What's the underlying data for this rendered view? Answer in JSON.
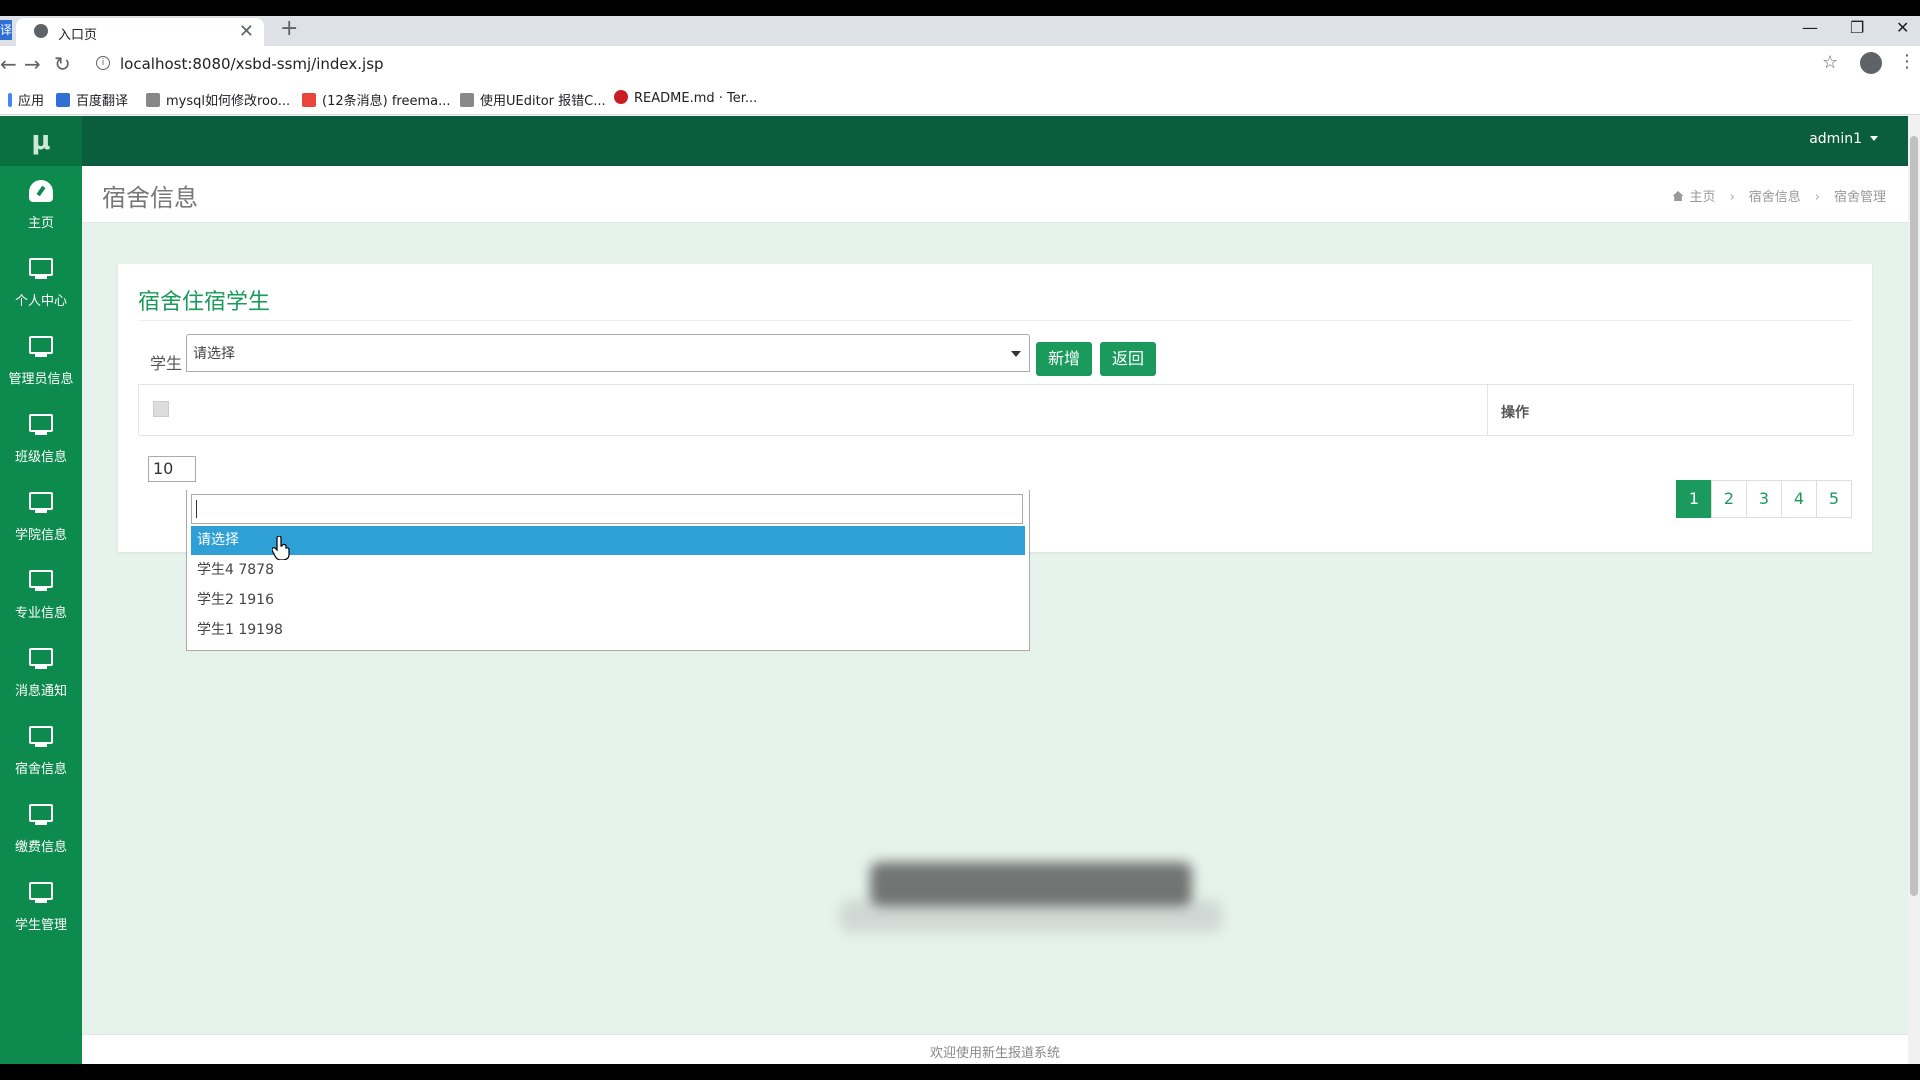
{
  "browser": {
    "app_badge": "译",
    "tab_title": "入口页",
    "tab_close": "✕",
    "new_tab": "+",
    "url": "localhost:8080/xsbd-ssmj/index.jsp",
    "bookmarks": [
      "应用",
      "百度翻译",
      "mysql如何修改roo...",
      "(12条消息) freema...",
      "使用UEditor 报错C...",
      "README.md · Ter..."
    ]
  },
  "brand": {
    "logo": "μ",
    "accent": "#0d8a4e",
    "topbar": "#0a5e3d",
    "highlight": "#2ea0d6"
  },
  "sidebar": {
    "items": [
      {
        "label": "主页",
        "icon": "dashboard-icon"
      },
      {
        "label": "个人中心",
        "icon": "monitor-icon"
      },
      {
        "label": "管理员信息",
        "icon": "monitor-icon"
      },
      {
        "label": "班级信息",
        "icon": "monitor-icon"
      },
      {
        "label": "学院信息",
        "icon": "monitor-icon"
      },
      {
        "label": "专业信息",
        "icon": "monitor-icon"
      },
      {
        "label": "消息通知",
        "icon": "monitor-icon"
      },
      {
        "label": "宿舍信息",
        "icon": "monitor-icon"
      },
      {
        "label": "缴费信息",
        "icon": "monitor-icon"
      },
      {
        "label": "学生管理",
        "icon": "monitor-icon"
      }
    ]
  },
  "header": {
    "user": "admin1"
  },
  "page": {
    "title": "宿舍信息",
    "breadcrumb": [
      "主页",
      "宿舍信息",
      "宿舍管理"
    ]
  },
  "panel": {
    "title": "宿舍住宿学生",
    "filter_label": "学生",
    "select_value": "请选择",
    "add_button": "新增",
    "back_button": "返回",
    "table_header_ops": "操作",
    "page_size": "10",
    "pages": [
      "1",
      "2",
      "3",
      "4",
      "5"
    ],
    "active_page": "1"
  },
  "dropdown": {
    "options": [
      "请选择",
      "学生4 7878",
      "学生2 1916",
      "学生1 19198"
    ],
    "highlighted": "请选择"
  },
  "footer": {
    "text": "欢迎使用新生报道系统"
  }
}
